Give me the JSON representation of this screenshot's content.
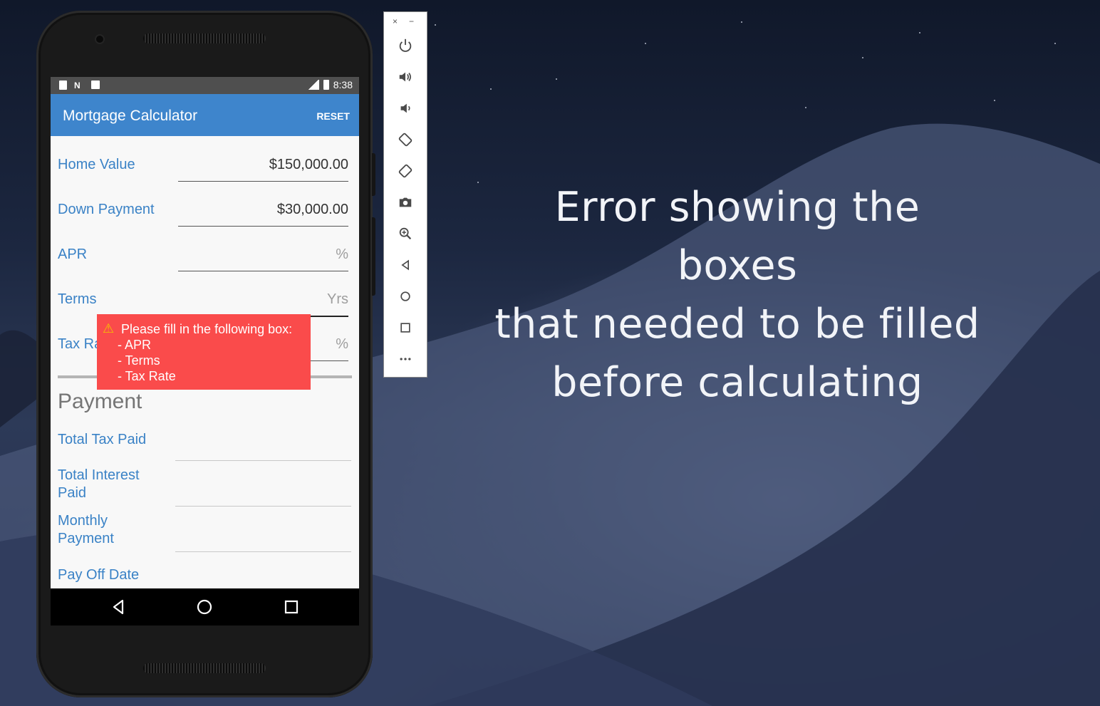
{
  "status_bar": {
    "time": "8:38"
  },
  "app_bar": {
    "title": "Mortgage Calculator",
    "reset_label": "RESET"
  },
  "inputs": [
    {
      "label": "Home Value",
      "value": "$150,000.00",
      "placeholder": ""
    },
    {
      "label": "Down Payment",
      "value": "$30,000.00",
      "placeholder": ""
    },
    {
      "label": "APR",
      "value": "",
      "placeholder": "%"
    },
    {
      "label": "Terms",
      "value": "",
      "placeholder": "Yrs"
    },
    {
      "label": "Tax Rate",
      "value": "",
      "placeholder": "%"
    }
  ],
  "section_title": "Payment",
  "outputs": [
    {
      "label": "Total Tax Paid"
    },
    {
      "label": "Total Interest Paid",
      "line1": "Total Interest",
      "line2": "Paid"
    },
    {
      "label": "Monthly Payment",
      "line1": "Monthly",
      "line2": "Payment"
    },
    {
      "label": "Pay Off Date"
    }
  ],
  "toast": {
    "message": "Please fill in the following box:",
    "items": [
      "- APR",
      "- Terms",
      "- Tax Rate"
    ],
    "color": "#fa4b4b"
  },
  "emulator_toolbar": {
    "close": "×",
    "minimize": "−",
    "buttons": [
      "power-icon",
      "volume-up-icon",
      "volume-down-icon",
      "rotate-left-icon",
      "rotate-right-icon",
      "camera-icon",
      "zoom-icon",
      "back-icon",
      "home-icon",
      "overview-icon",
      "more-icon"
    ]
  },
  "caption": {
    "line1": "Error showing the boxes",
    "line2": "that needed to be filled",
    "line3": "before calculating"
  },
  "colors": {
    "accent": "#3e85cc",
    "label": "#3a82c6"
  }
}
